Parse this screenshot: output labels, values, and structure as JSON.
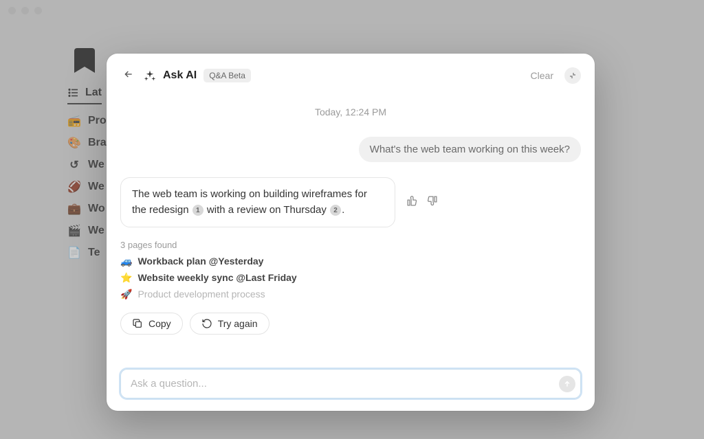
{
  "window": {
    "underlay_tab_label": "Lat",
    "underlay_items": [
      {
        "icon": "📻",
        "label": "Pro"
      },
      {
        "icon": "🎨",
        "label": "Bra"
      },
      {
        "icon": "↺",
        "label": "We"
      },
      {
        "icon": "🏈",
        "label": "We"
      },
      {
        "icon": "💼",
        "label": "Wo"
      },
      {
        "icon": "🎬",
        "label": "We"
      },
      {
        "icon": "📄",
        "label": "Te"
      }
    ]
  },
  "modal": {
    "title": "Ask AI",
    "badge": "Q&A Beta",
    "clear_label": "Clear",
    "timestamp": "Today, 12:24 PM",
    "user_message": "What's the web team working on this week?",
    "ai_message_part1": "The web team is working on building wireframes for the redesign",
    "ai_message_part2": "with a review on Thursday",
    "ref1": "1",
    "ref2": "2",
    "sources_label": "3 pages found",
    "sources": [
      {
        "emoji": "🚙",
        "title": "Workback plan @Yesterday",
        "dim": false
      },
      {
        "emoji": "⭐",
        "title": "Website weekly sync @Last Friday",
        "dim": false
      },
      {
        "emoji": "🚀",
        "title": "Product development process",
        "dim": true
      }
    ],
    "copy_label": "Copy",
    "try_again_label": "Try again",
    "input_placeholder": "Ask a question..."
  }
}
